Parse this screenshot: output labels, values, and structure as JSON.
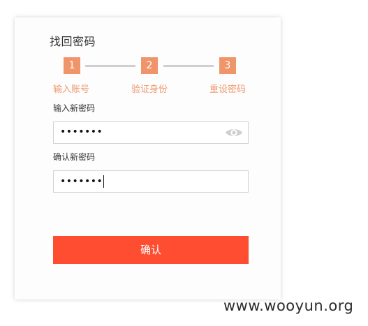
{
  "form": {
    "title": "找回密码",
    "steps": [
      {
        "number": "1",
        "label": "输入账号"
      },
      {
        "number": "2",
        "label": "验证身份"
      },
      {
        "number": "3",
        "label": "重设密码"
      }
    ],
    "new_password": {
      "label": "输入新密码",
      "value": "•••••••"
    },
    "confirm_password": {
      "label": "确认新密码",
      "value": "•••••••"
    },
    "confirm_button_label": "确认"
  },
  "watermark": "www.wooyun.org",
  "colors": {
    "step_accent": "#f0956a",
    "button_bg": "#ff4d31"
  }
}
